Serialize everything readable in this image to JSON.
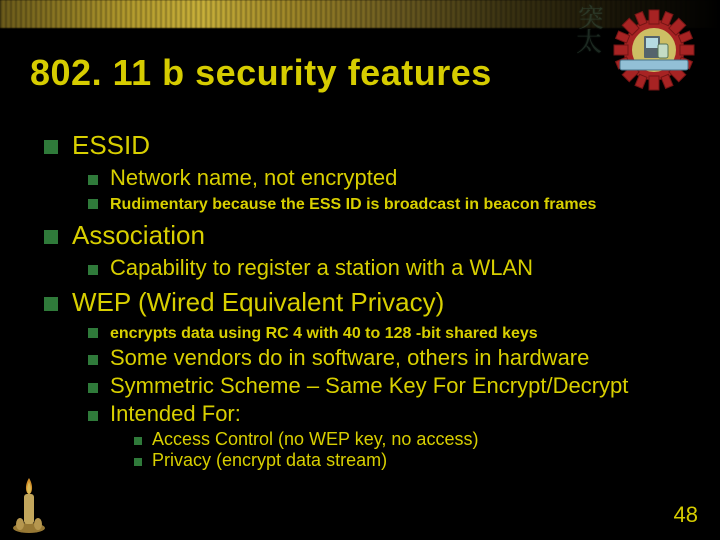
{
  "title": "802. 11 b security features",
  "slide_number": "48",
  "watermark": {
    "char1": "突",
    "char2": "太"
  },
  "bullets": [
    {
      "label": "ESSID",
      "children": [
        {
          "label": "Network name, not encrypted",
          "small": false
        },
        {
          "label": "Rudimentary because the ESS ID is broadcast in beacon frames",
          "small": true
        }
      ]
    },
    {
      "label": "Association",
      "children": [
        {
          "label": "Capability to register a station with a WLAN",
          "small": false
        }
      ]
    },
    {
      "label": "WEP (Wired  Equivalent Privacy)",
      "children": [
        {
          "label": "encrypts data using RC 4 with 40 to 128 -bit shared keys",
          "small": true
        },
        {
          "label": "Some vendors do in software, others in hardware",
          "small": false
        },
        {
          "label": "Symmetric Scheme – Same Key For Encrypt/Decrypt",
          "small": false
        },
        {
          "label": "Intended For:",
          "small": false,
          "children": [
            {
              "label": "Access Control (no WEP key, no access)"
            },
            {
              "label": "Privacy (encrypt data stream)"
            }
          ]
        }
      ]
    }
  ]
}
